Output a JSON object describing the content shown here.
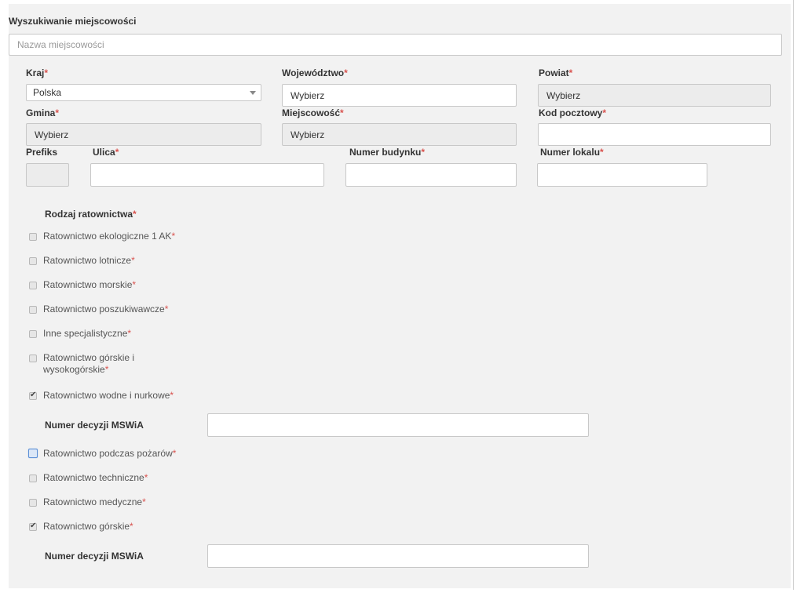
{
  "search": {
    "title": "Wyszukiwanie miejscowości",
    "placeholder": "Nazwa miejscowości"
  },
  "address": {
    "country_label": "Kraj",
    "country_value": "Polska",
    "voivodeship_label": "Województwo",
    "voivodeship_value": "Wybierz",
    "county_label": "Powiat",
    "county_value": "Wybierz",
    "commune_label": "Gmina",
    "commune_value": "Wybierz",
    "locality_label": "Miejscowość",
    "locality_value": "Wybierz",
    "postal_label": "Kod pocztowy",
    "postal_value": "",
    "prefix_label": "Prefiks",
    "street_label": "Ulica",
    "building_label": "Numer budynku",
    "unit_label": "Numer lokalu",
    "required_mark": "*"
  },
  "rescue": {
    "title": "Rodzaj ratownictwa",
    "options": [
      {
        "label": "Ratownictwo ekologiczne 1 AK",
        "checked": false
      },
      {
        "label": "Ratownictwo lotnicze",
        "checked": false
      },
      {
        "label": "Ratownictwo morskie",
        "checked": false
      },
      {
        "label": "Ratownictwo poszukiwawcze",
        "checked": false
      },
      {
        "label": "Inne specjalistyczne",
        "checked": false
      },
      {
        "label": "Ratownictwo górskie i",
        "label2": "wysokogórskie",
        "checked": false
      },
      {
        "label": "Ratownictwo wodne i nurkowe",
        "checked": true
      },
      {
        "label": "Ratownictwo podczas pożarów",
        "checked": false
      },
      {
        "label": "Ratownictwo techniczne",
        "checked": false
      },
      {
        "label": "Ratownictwo medyczne",
        "checked": false
      },
      {
        "label": "Ratownictwo górskie",
        "checked": true
      }
    ],
    "decision_label": "Numer decyzji MSWiA",
    "decision_value_1": "",
    "decision_value_2": ""
  }
}
